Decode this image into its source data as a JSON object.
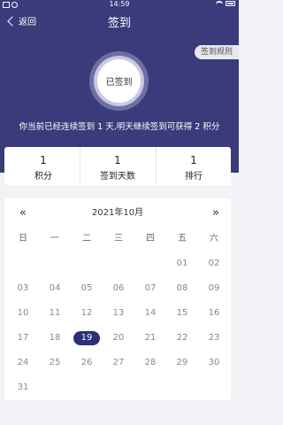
{
  "status_bar": {
    "time": "14:59"
  },
  "nav": {
    "back_label": "返回",
    "title": "签到"
  },
  "rules_button": "签到规则",
  "sign_button": "已签到",
  "streak_message": "你当前已经连续签到 1 天,明天继续签到可获得 2 积分",
  "stats": [
    {
      "value": "1",
      "label": "积分"
    },
    {
      "value": "1",
      "label": "签到天数"
    },
    {
      "value": "1",
      "label": "排行"
    }
  ],
  "calendar": {
    "prev": "«",
    "next": "»",
    "month_label": "2021年10月",
    "weekdays": [
      "日",
      "一",
      "二",
      "三",
      "四",
      "五",
      "六"
    ],
    "today": "19",
    "weeks": [
      [
        "",
        "",
        "",
        "",
        "",
        "01",
        "02"
      ],
      [
        "03",
        "04",
        "05",
        "06",
        "07",
        "08",
        "09"
      ],
      [
        "10",
        "11",
        "12",
        "13",
        "14",
        "15",
        "16"
      ],
      [
        "17",
        "18",
        "19",
        "20",
        "21",
        "22",
        "23"
      ],
      [
        "24",
        "25",
        "26",
        "27",
        "28",
        "29",
        "30"
      ],
      [
        "31",
        "",
        "",
        "",
        "",
        "",
        ""
      ]
    ]
  },
  "colors": {
    "header": "#3a3b7a",
    "today_badge": "#2d2f77"
  }
}
